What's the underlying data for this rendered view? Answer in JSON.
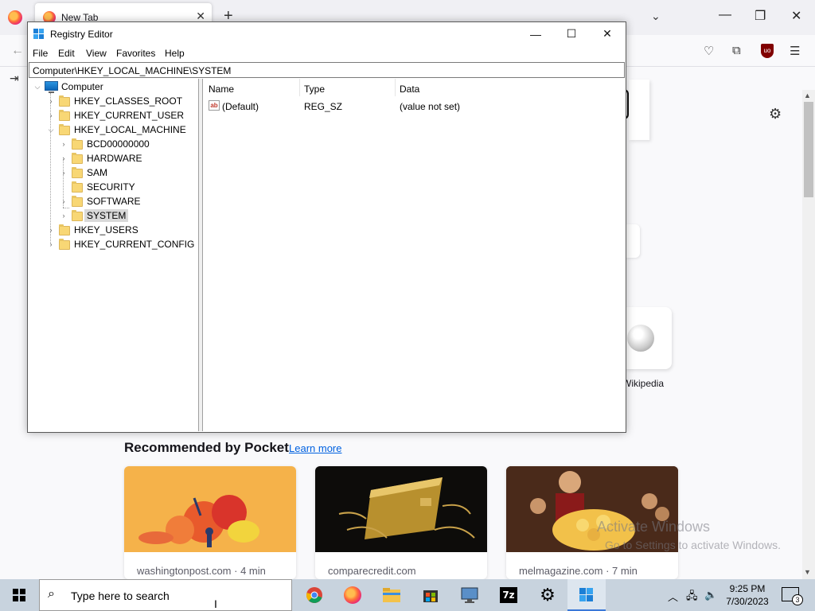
{
  "firefox": {
    "tab_title": "New Tab",
    "pocket": {
      "heading": "Recommended by Pocket",
      "learn_more": "Learn more",
      "cards": [
        {
          "source": "washingtonpost.com · 4 min"
        },
        {
          "source": "comparecredit.com"
        },
        {
          "source": "melmagazine.com · 7 min"
        }
      ]
    },
    "shortcut_label": "Wikipedia",
    "watermark_line1": "Activate Windows",
    "watermark_line2": "Go to Settings to activate Windows."
  },
  "regedit": {
    "title": "Registry Editor",
    "menu": [
      "File",
      "Edit",
      "View",
      "Favorites",
      "Help"
    ],
    "address": "Computer\\HKEY_LOCAL_MACHINE\\SYSTEM",
    "tree": {
      "root": "Computer",
      "hives": [
        "HKEY_CLASSES_ROOT",
        "HKEY_CURRENT_USER",
        "HKEY_LOCAL_MACHINE",
        "HKEY_USERS",
        "HKEY_CURRENT_CONFIG"
      ],
      "hklm_children": [
        "BCD00000000",
        "HARDWARE",
        "SAM",
        "SECURITY",
        "SOFTWARE",
        "SYSTEM"
      ],
      "selected": "SYSTEM"
    },
    "columns": [
      "Name",
      "Type",
      "Data"
    ],
    "values": [
      {
        "name": "(Default)",
        "type": "REG_SZ",
        "data": "(value not set)"
      }
    ]
  },
  "taskbar": {
    "search_placeholder": "Type here to search",
    "time": "9:25 PM",
    "date": "7/30/2023",
    "notification_count": "3"
  }
}
